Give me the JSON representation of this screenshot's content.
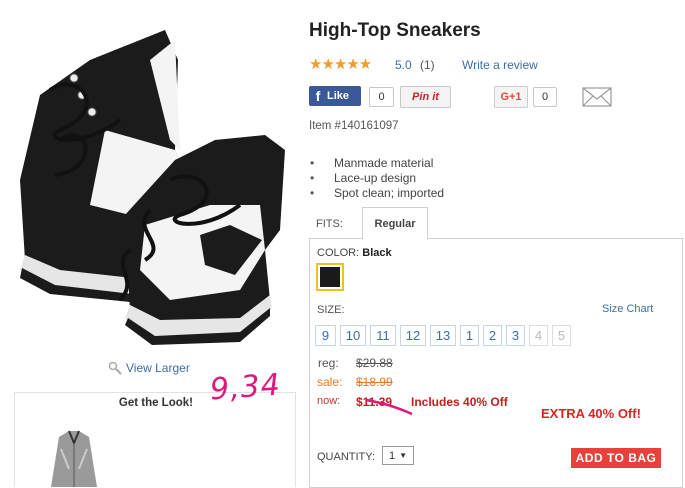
{
  "product": {
    "title": "High-Top Sneakers",
    "stars": "★★★★★",
    "rating": "5.0",
    "review_count": "(1)",
    "write_review": "Write a review",
    "item_number": "Item #140161097",
    "features": [
      "Manmade material",
      "Lace-up design",
      "Spot clean; imported"
    ]
  },
  "social": {
    "fb_label": "Like",
    "fb_count": "0",
    "pin_label": "Pin it",
    "gplus_label": "G+1",
    "gplus_count": "0"
  },
  "image": {
    "view_larger": "View Larger",
    "get_the_look": "Get the Look!"
  },
  "annotation": {
    "handwritten": "9,34"
  },
  "options": {
    "fits_label": "FITS:",
    "fits_selected": "Regular",
    "color_label": "COLOR:",
    "color_value": "Black",
    "size_label": "SIZE:",
    "size_chart": "Size Chart",
    "sizes": [
      "9",
      "10",
      "11",
      "12",
      "13",
      "1",
      "2",
      "3",
      "4",
      "5"
    ]
  },
  "pricing": {
    "reg_label": "reg:",
    "reg_value": "$29.88",
    "sale_label": "sale:",
    "sale_value": "$18.99",
    "now_label": "now:",
    "now_value": "$11.39",
    "now_note": "Includes 40% Off",
    "extra": "EXTRA 40% Off!"
  },
  "cart": {
    "quantity_label": "QUANTITY:",
    "quantity_value": "1",
    "add_to_bag": "ADD TO BAG"
  },
  "colors": {
    "link": "#3b6ea5",
    "accent_red": "#e8403a",
    "star": "#f39c2a",
    "facebook": "#3b5998"
  }
}
